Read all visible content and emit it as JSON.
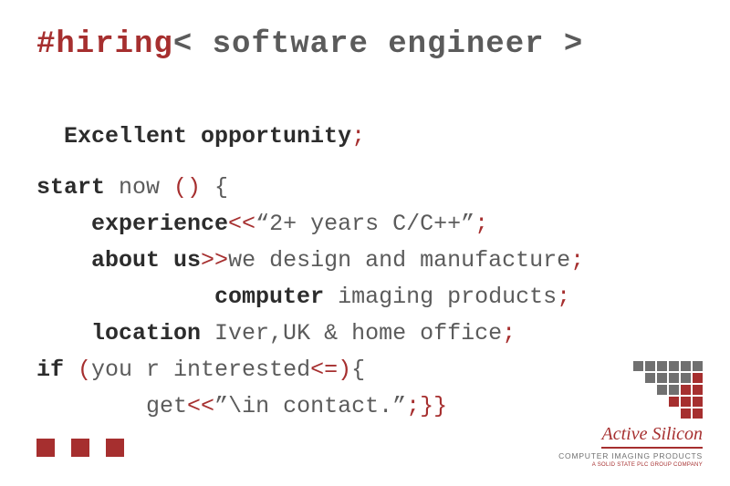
{
  "colors": {
    "accent": "#a62f2f",
    "text": "#5b5b5b",
    "dark": "#2c2c2c"
  },
  "heading": {
    "hash": "#hiring",
    "lt": "<",
    "title": " software engineer ",
    "gt": ">"
  },
  "subhead": {
    "text": "Excellent opportunity",
    "semi": ";"
  },
  "l1": {
    "a": "start",
    "b": " now ",
    "c": "()",
    "d": " {"
  },
  "l2": {
    "indent": "    ",
    "a": "experience",
    "op": "<<",
    "q1": "“",
    "b": "2+ years C/C++",
    "q2": "”",
    "semi": ";"
  },
  "l3": {
    "indent": "    ",
    "a": "about us",
    "op": ">>",
    "b": "we design and manufacture",
    "semi": ";"
  },
  "l4": {
    "indent": "             ",
    "a": "computer",
    "b": " imaging products",
    "semi": ";"
  },
  "l5": {
    "indent": "    ",
    "a": "location",
    "b": " Iver,UK & home office",
    "semi": ";"
  },
  "l6": {
    "a": "if ",
    "p1": "(",
    "b": "you r interested",
    "op": "<=",
    "p2": ")",
    "brace": "{"
  },
  "l7": {
    "indent": "        ",
    "a": "get",
    "op": "<<",
    "q": "”",
    "b": "\\in contact.",
    "q2": "”",
    "semi": ";",
    "close": "}}"
  },
  "logo": {
    "brand": "Active Silicon",
    "tagline": "COMPUTER IMAGING PRODUCTS",
    "subtag": "A SOLID STATE PLC GROUP COMPANY"
  }
}
